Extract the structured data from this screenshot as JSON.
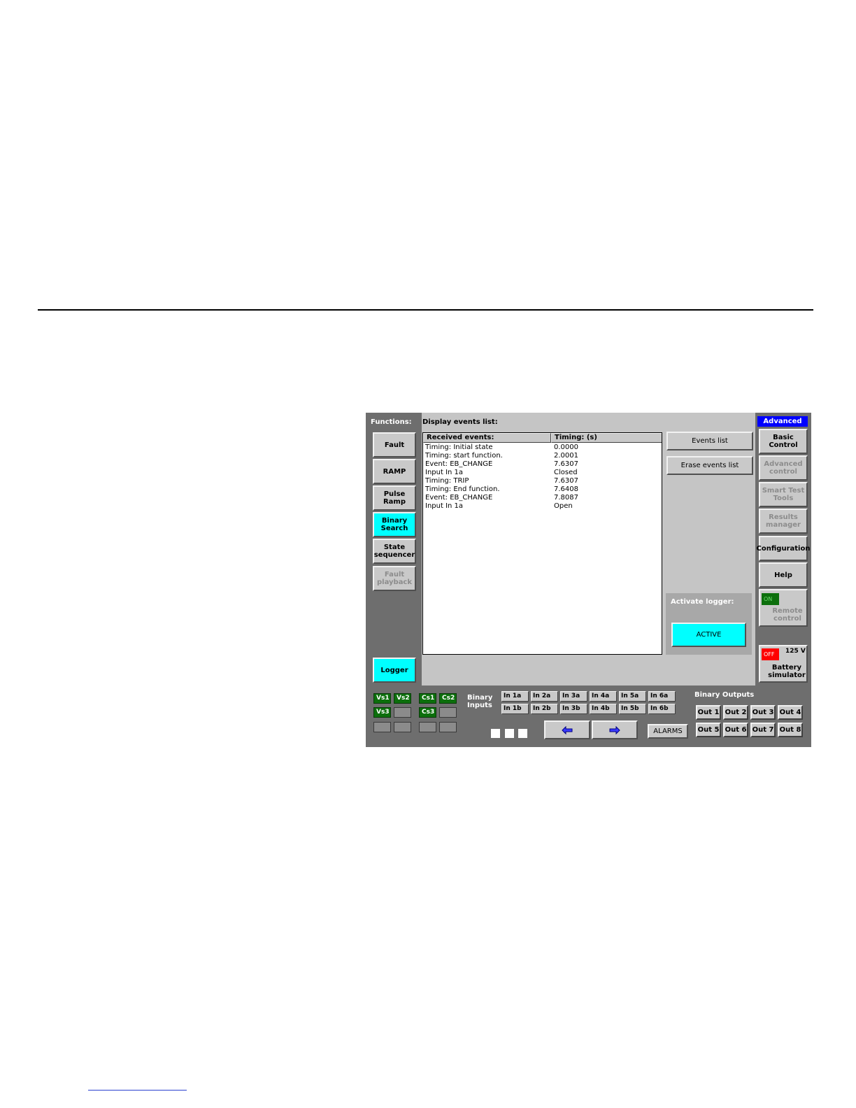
{
  "functions_label": "Functions:",
  "functions": [
    "Fault",
    "RAMP",
    "Pulse\nRamp",
    "Binary\nSearch",
    "State\nsequencer",
    "Fault\nplayback"
  ],
  "logger_button": "Logger",
  "display_title": "Display events list:",
  "events": {
    "col_event": "Received events:",
    "col_timing": "Timing: (s)",
    "rows": [
      {
        "event": "Timing: Initial state",
        "timing": "0.0000"
      },
      {
        "event": "Timing: start function.",
        "timing": "2.0001"
      },
      {
        "event": "Event: EB_CHANGE",
        "timing": "7.6307"
      },
      {
        "event": "Input In 1a",
        "timing": "Closed"
      },
      {
        "event": "Timing: TRIP",
        "timing": "7.6307"
      },
      {
        "event": "Timing: End function.",
        "timing": "7.6408"
      },
      {
        "event": "Event: EB_CHANGE",
        "timing": "7.8087"
      },
      {
        "event": "Input In 1a",
        "timing": "Open"
      }
    ]
  },
  "events_list_button": "Events list",
  "erase_events_button": "Erase events list",
  "activate_logger_label": "Activate logger:",
  "active_button": "ACTIVE",
  "mode_badge": "Advanced",
  "right_menu": [
    "Basic\nControl",
    "Advanced\ncontrol",
    "Smart Test\nTools",
    "Results\nmanager",
    "Configuration",
    "Help"
  ],
  "remote": {
    "state": "ON",
    "label": "Remote\ncontrol"
  },
  "battery": {
    "state": "OFF",
    "voltage": "125 V",
    "label": "Battery\nsimulator"
  },
  "sources": [
    "Vs1",
    "Vs2",
    "Vs3",
    "Cs1",
    "Cs2",
    "Cs3"
  ],
  "binary_inputs_label": "Binary\nInputs",
  "binary_inputs_top": [
    "In 1a",
    "In 2a",
    "In 3a",
    "In 4a",
    "In 5a",
    "In 6a"
  ],
  "binary_inputs_bottom": [
    "In 1b",
    "In 2b",
    "In 3b",
    "In 4b",
    "In 5b",
    "In 6b"
  ],
  "alarms_button": "ALARMS",
  "binary_outputs_label": "Binary Outputs",
  "outputs": [
    "Out 1",
    "Out 2",
    "Out 3",
    "Out 4",
    "Out 5",
    "Out 6",
    "Out 7",
    "Out 8"
  ],
  "colors": {
    "accent": "#00ffff",
    "badge": "#0000ff",
    "on": "#0c6f0c",
    "off": "#ff0000"
  }
}
